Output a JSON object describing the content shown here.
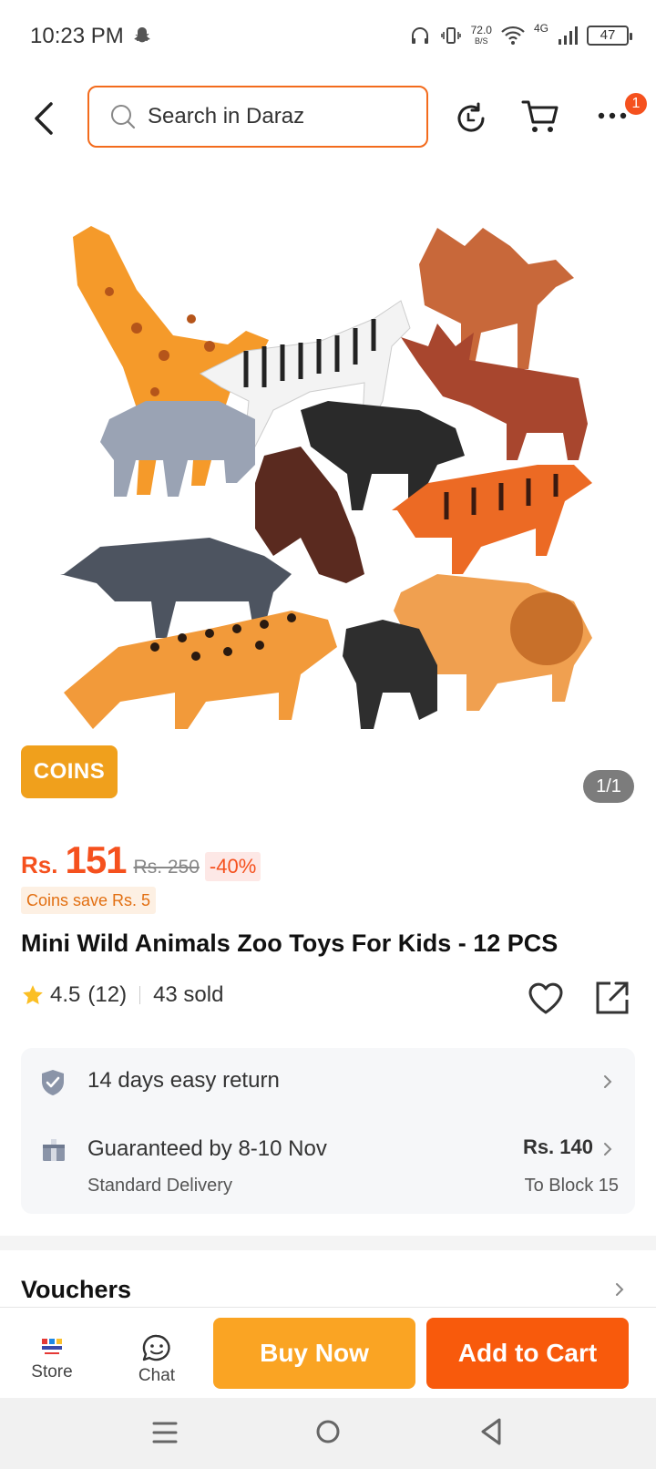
{
  "status_bar": {
    "time": "10:23 PM",
    "net_speed_value": "72.0",
    "net_speed_unit": "B/S",
    "network": "4G",
    "battery": "47"
  },
  "header": {
    "search_placeholder": "Search in Daraz",
    "notification_count": "1"
  },
  "gallery": {
    "coins_tag": "COINS",
    "counter": "1/1"
  },
  "price": {
    "currency": "Rs.",
    "current": "151",
    "original": "Rs. 250",
    "discount": "-40%",
    "coins_save": "Coins save Rs. 5"
  },
  "product": {
    "title": "Mini Wild Animals Zoo Toys For Kids - 12 PCS",
    "rating": "4.5",
    "reviews": "(12)",
    "sold": "43 sold"
  },
  "services": {
    "return_policy": "14 days easy return",
    "guarantee": "Guaranteed by 8-10 Nov",
    "delivery_type": "Standard Delivery",
    "delivery_fee": "Rs. 140",
    "destination": "To Block 15"
  },
  "sections": {
    "vouchers": "Vouchers"
  },
  "actions": {
    "store": "Store",
    "chat": "Chat",
    "buy_now": "Buy Now",
    "add_to_cart": "Add to Cart"
  },
  "colors": {
    "accent": "#f5511e",
    "buy_now": "#faa423",
    "add_to_cart": "#f85a0c",
    "coins": "#f0a01c"
  }
}
